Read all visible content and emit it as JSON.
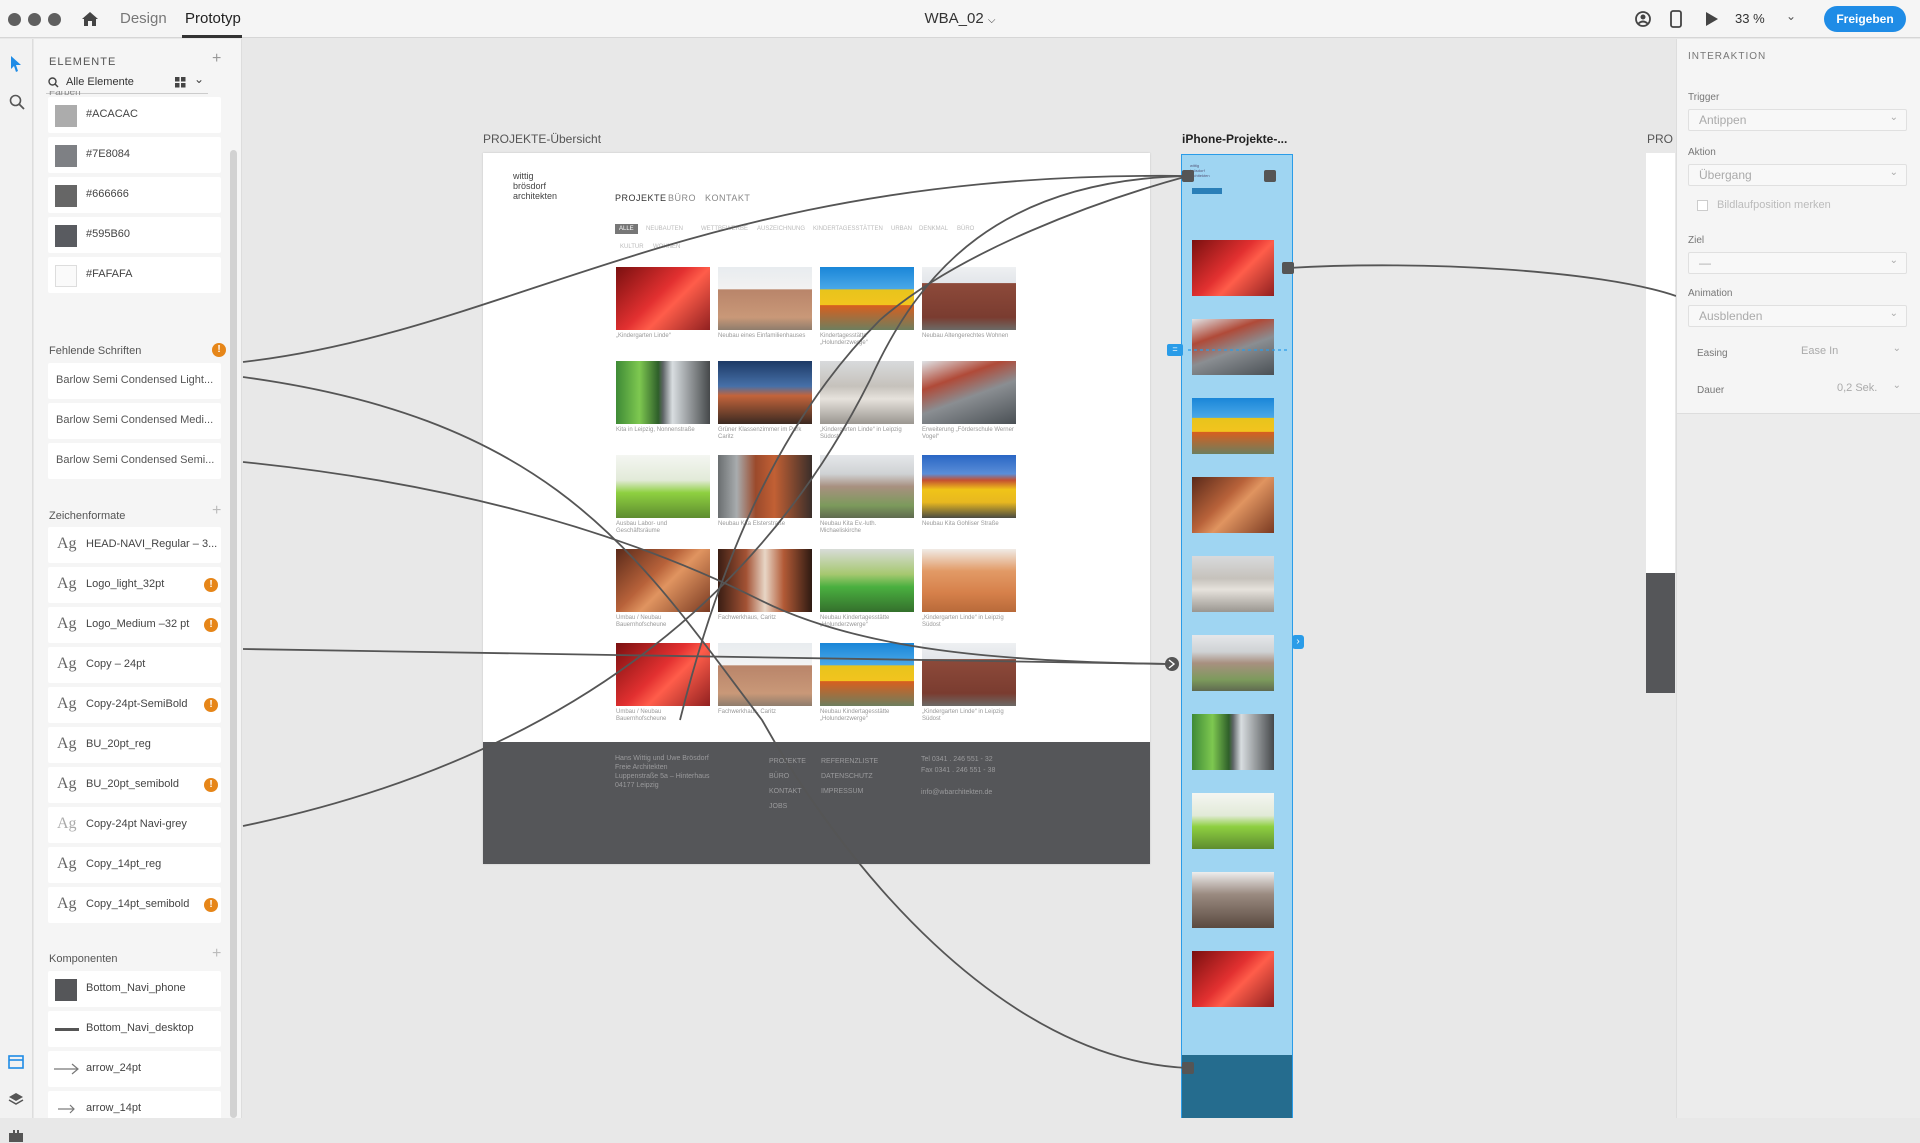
{
  "titlebar": {
    "tabs": [
      "Design",
      "Prototyp"
    ],
    "active_tab": "Prototyp",
    "doc_title": "WBA_02",
    "zoom": "33 %",
    "share_label": "Freigeben"
  },
  "assets": {
    "header": "ELEMENTE",
    "search_value": "Alle Elemente",
    "colors_header": "Farben",
    "colors": [
      {
        "hex": "#ACACAC",
        "label": "#ACACAC"
      },
      {
        "hex": "#7E8084",
        "label": "#7E8084"
      },
      {
        "hex": "#666666",
        "label": "#666666"
      },
      {
        "hex": "#595B60",
        "label": "#595B60"
      },
      {
        "hex": "#FAFAFA",
        "label": "#FAFAFA"
      }
    ],
    "missing_fonts_header": "Fehlende Schriften",
    "missing_fonts": [
      "Barlow Semi Condensed Light...",
      "Barlow Semi Condensed Medi...",
      "Barlow Semi Condensed Semi..."
    ],
    "char_styles_header": "Zeichenformate",
    "char_styles": [
      {
        "label": "HEAD-NAVI_Regular – 3...",
        "warn": false
      },
      {
        "label": "Logo_light_32pt",
        "warn": true
      },
      {
        "label": "Logo_Medium –32 pt",
        "warn": true
      },
      {
        "label": "Copy – 24pt",
        "warn": false
      },
      {
        "label": "Copy-24pt-SemiBold",
        "warn": true
      },
      {
        "label": "BU_20pt_reg",
        "warn": false
      },
      {
        "label": "BU_20pt_semibold",
        "warn": true
      },
      {
        "label": "Copy-24pt Navi-grey",
        "warn": false
      },
      {
        "label": "Copy_14pt_reg",
        "warn": false
      },
      {
        "label": "Copy_14pt_semibold",
        "warn": true
      }
    ],
    "components_header": "Komponenten",
    "components": [
      "Bottom_Navi_phone",
      "Bottom_Navi_desktop",
      "arrow_24pt",
      "arrow_14pt"
    ]
  },
  "canvas": {
    "artboard1_label": "PROJEKTE-Übersicht",
    "artboard2_label": "iPhone-Projekte-...",
    "artboard3_label": "PRO",
    "logo": [
      "wittig",
      "brösdorf",
      "architekten"
    ],
    "nav": [
      "PROJEKTE",
      "BÜRO",
      "KONTAKT"
    ],
    "filters": [
      "ALLE",
      "NEUBAUTEN",
      "WETTBEWERBE",
      "AUSZEICHNUNG",
      "KINDERTAGESSTÄTTEN",
      "URBAN",
      "DENKMAL",
      "BÜRO",
      "KULTUR",
      "WOHNEN"
    ],
    "captions": [
      "„Kindergarten Linde“",
      "Neubau eines Einfamilienhauses",
      "Kindertagesstätte „Holunderzwerge“",
      "Neubau Altengerechtes Wohnen",
      "Kita in Leipzig, Nonnenstraße",
      "Grüner Klassenzimmer im Park Caritz",
      "„Kindergarten Linde“ in Leipzig Südost",
      "Erweiterung „Förderschule Werner Vogel“",
      "Ausbau Labor- und Geschäftsräume",
      "Neubau Kita Elsterstraße",
      "Neubau Kita Ev.-luth. Michaeliskirche",
      "Neubau Kita Gohliser Straße",
      "Umbau / Neubau Bauernhofscheune",
      "Fachwerkhaus, Caritz",
      "Neubau Kindertagesstätte „Holunderzwerge“",
      "„Kindergarten Linde“ in Leipzig Südost",
      "Umbau / Neubau Bauernhofscheune",
      "Fachwerkhaus, Caritz",
      "Neubau Kindertagesstätte „Holunderzwerge“",
      "„Kindergarten Linde“ in Leipzig Südost"
    ],
    "footer": {
      "address": [
        "Hans Wittig und Uwe Brösdorf",
        "Freie Architekten",
        "Luppenstraße 5a – Hinterhaus",
        "04177 Leipzig"
      ],
      "nav1": [
        "PROJEKTE",
        "BÜRO",
        "KONTAKT",
        "JOBS"
      ],
      "nav2": [
        "REFERENZLISTE",
        "DATENSCHUTZ",
        "IMPRESSUM"
      ],
      "contact": [
        "Tel  0341 . 246 551 - 32",
        "Fax  0341 . 246 551 - 38",
        "",
        "info@wbarchitekten.de"
      ]
    }
  },
  "interaction": {
    "header": "INTERAKTION",
    "trigger_label": "Trigger",
    "trigger_value": "Antippen",
    "action_label": "Aktion",
    "action_value": "Übergang",
    "preserve_scroll_label": "Bildlaufposition merken",
    "target_label": "Ziel",
    "target_value": "—",
    "animation_label": "Animation",
    "animation_value": "Ausblenden",
    "easing_label": "Easing",
    "easing_value": "Ease In",
    "duration_label": "Dauer",
    "duration_value": "0,2 Sek."
  },
  "colors": {
    "accent": "#1f8ce6",
    "warning": "#e68619",
    "selection_fill": "#9fd5f2",
    "footer_dark": "#555659"
  }
}
